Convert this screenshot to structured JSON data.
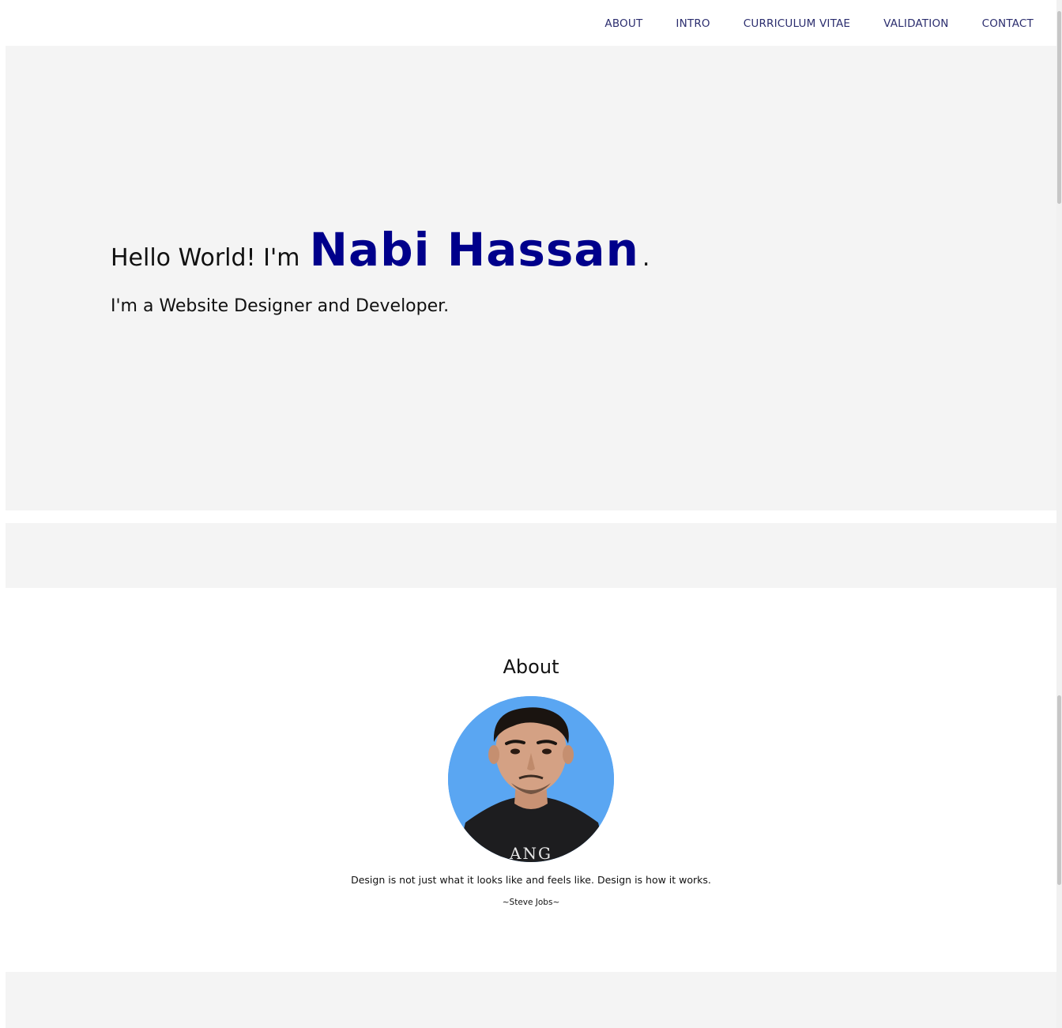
{
  "nav": {
    "items": [
      {
        "label": "ABOUT"
      },
      {
        "label": "INTRO"
      },
      {
        "label": "CURRICULUM VITAE"
      },
      {
        "label": "VALIDATION"
      },
      {
        "label": "CONTACT"
      }
    ]
  },
  "hero": {
    "greeting": "Hello World! I'm",
    "name": "Nabi Hassan",
    "period": ".",
    "tagline": "I'm a Website Designer and Developer."
  },
  "about": {
    "title": "About",
    "quote": "Design is not just what it looks like and feels like. Design is how it works.",
    "author": "~Steve Jobs~",
    "shirt_text": "ANG"
  },
  "colors": {
    "nav_link": "#2b2d6e",
    "name": "#00008b",
    "section_bg": "#f4f4f4",
    "avatar_bg": "#5aa6f2"
  }
}
